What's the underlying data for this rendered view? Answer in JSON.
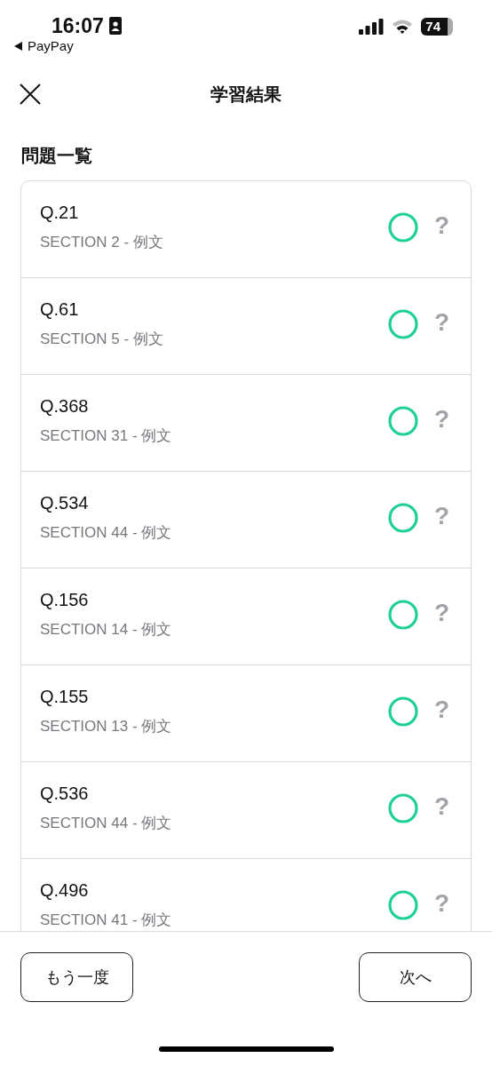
{
  "status_bar": {
    "time": "16:07",
    "back_app": "PayPay",
    "battery": "74"
  },
  "nav": {
    "title": "学習結果"
  },
  "section_title": "問題一覧",
  "questions": [
    {
      "number": "Q.21",
      "section": "SECTION 2 - 例文",
      "correct": true,
      "help": "?"
    },
    {
      "number": "Q.61",
      "section": "SECTION 5 - 例文",
      "correct": true,
      "help": "?"
    },
    {
      "number": "Q.368",
      "section": "SECTION 31 - 例文",
      "correct": true,
      "help": "?"
    },
    {
      "number": "Q.534",
      "section": "SECTION 44 - 例文",
      "correct": true,
      "help": "?"
    },
    {
      "number": "Q.156",
      "section": "SECTION 14 - 例文",
      "correct": true,
      "help": "?"
    },
    {
      "number": "Q.155",
      "section": "SECTION 13 - 例文",
      "correct": true,
      "help": "?"
    },
    {
      "number": "Q.536",
      "section": "SECTION 44 - 例文",
      "correct": true,
      "help": "?"
    },
    {
      "number": "Q.496",
      "section": "SECTION 41 - 例文",
      "correct": true,
      "help": "?"
    }
  ],
  "buttons": [
    "もう一度",
    "次へ"
  ]
}
